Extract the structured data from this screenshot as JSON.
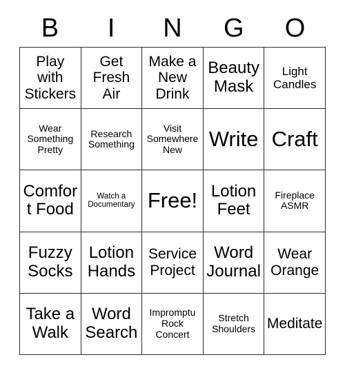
{
  "header": {
    "letters": [
      "B",
      "I",
      "N",
      "G",
      "O"
    ]
  },
  "grid": {
    "columns": 5,
    "rows": 5,
    "border_color": "#2b2b2b",
    "background_color": "#ffffff",
    "text_color": "#000000",
    "cells": [
      {
        "text": "Play with Stickers",
        "size": "fs-md",
        "free": false
      },
      {
        "text": "Get Fresh Air",
        "size": "fs-md",
        "free": false
      },
      {
        "text": "Make a New Drink",
        "size": "fs-md",
        "free": false
      },
      {
        "text": "Beauty Mask",
        "size": "fs-lg",
        "free": false
      },
      {
        "text": "Light Candles",
        "size": "fs-sm",
        "free": false
      },
      {
        "text": "Wear Something Pretty",
        "size": "fs-xs",
        "free": false
      },
      {
        "text": "Research Something",
        "size": "fs-xs",
        "free": false
      },
      {
        "text": "Visit Somewhere New",
        "size": "fs-xs",
        "free": false
      },
      {
        "text": "Write",
        "size": "fs-xl",
        "free": false
      },
      {
        "text": "Craft",
        "size": "fs-xl",
        "free": false
      },
      {
        "text": "Comfort Food",
        "size": "fs-lg",
        "free": false
      },
      {
        "text": "Watch a Documentary",
        "size": "fs-xxs",
        "free": false
      },
      {
        "text": "Free!",
        "size": "fs-xl",
        "free": true
      },
      {
        "text": "Lotion Feet",
        "size": "fs-lg",
        "free": false
      },
      {
        "text": "Fireplace ASMR",
        "size": "fs-xs",
        "free": false
      },
      {
        "text": "Fuzzy Socks",
        "size": "fs-lg",
        "free": false
      },
      {
        "text": "Lotion Hands",
        "size": "fs-lg",
        "free": false
      },
      {
        "text": "Service Project",
        "size": "fs-md",
        "free": false
      },
      {
        "text": "Word Journal",
        "size": "fs-lg",
        "free": false
      },
      {
        "text": "Wear Orange",
        "size": "fs-md",
        "free": false
      },
      {
        "text": "Take a Walk",
        "size": "fs-lg",
        "free": false
      },
      {
        "text": "Word Search",
        "size": "fs-lg",
        "free": false
      },
      {
        "text": "Impromptu Rock Concert",
        "size": "fs-xs",
        "free": false
      },
      {
        "text": "Stretch Shoulders",
        "size": "fs-xs",
        "free": false
      },
      {
        "text": "Meditate",
        "size": "fs-md",
        "free": false
      }
    ]
  }
}
